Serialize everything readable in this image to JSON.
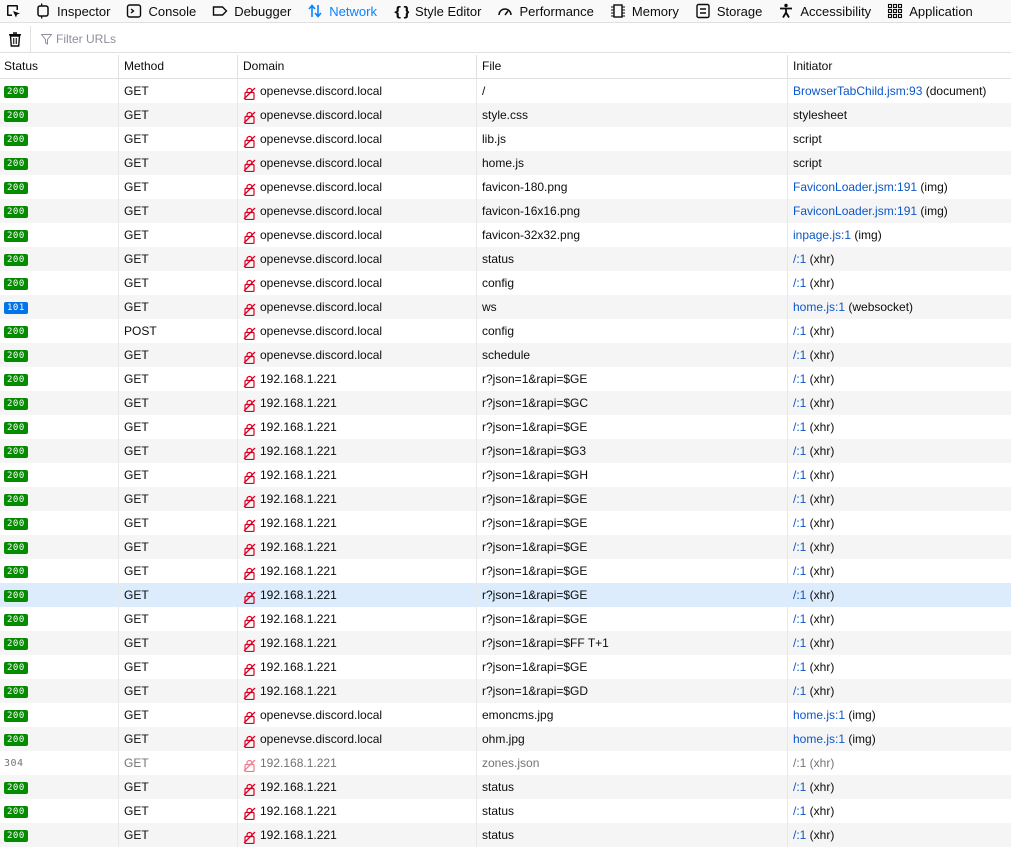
{
  "toolbar": {
    "tabs": [
      {
        "label": "Inspector",
        "icon": "inspector-icon"
      },
      {
        "label": "Console",
        "icon": "console-icon"
      },
      {
        "label": "Debugger",
        "icon": "debugger-icon"
      },
      {
        "label": "Network",
        "icon": "network-icon",
        "selected": true
      },
      {
        "label": "Style Editor",
        "icon": "style-editor-icon"
      },
      {
        "label": "Performance",
        "icon": "performance-icon"
      },
      {
        "label": "Memory",
        "icon": "memory-icon"
      },
      {
        "label": "Storage",
        "icon": "storage-icon"
      },
      {
        "label": "Accessibility",
        "icon": "accessibility-icon"
      },
      {
        "label": "Application",
        "icon": "application-icon"
      }
    ]
  },
  "filter": {
    "placeholder": "Filter URLs",
    "value": ""
  },
  "columns": {
    "status": "Status",
    "method": "Method",
    "domain": "Domain",
    "file": "File",
    "initiator": "Initiator"
  },
  "colors": {
    "accent": "#0a84ff",
    "status_ok": "#058b00",
    "status_switching": "#0074e8",
    "link": "#0b56c8",
    "selected_row": "#dcecfc"
  },
  "rows": [
    {
      "status": "200",
      "method": "GET",
      "domain": "openevse.discord.local",
      "file": "/",
      "init_link": "BrowserTabChild.jsm:93",
      "init_suffix": " (document)"
    },
    {
      "status": "200",
      "method": "GET",
      "domain": "openevse.discord.local",
      "file": "style.css",
      "init_link": "",
      "init_suffix": "stylesheet"
    },
    {
      "status": "200",
      "method": "GET",
      "domain": "openevse.discord.local",
      "file": "lib.js",
      "init_link": "",
      "init_suffix": "script"
    },
    {
      "status": "200",
      "method": "GET",
      "domain": "openevse.discord.local",
      "file": "home.js",
      "init_link": "",
      "init_suffix": "script"
    },
    {
      "status": "200",
      "method": "GET",
      "domain": "openevse.discord.local",
      "file": "favicon-180.png",
      "init_link": "FaviconLoader.jsm:191",
      "init_suffix": " (img)"
    },
    {
      "status": "200",
      "method": "GET",
      "domain": "openevse.discord.local",
      "file": "favicon-16x16.png",
      "init_link": "FaviconLoader.jsm:191",
      "init_suffix": " (img)"
    },
    {
      "status": "200",
      "method": "GET",
      "domain": "openevse.discord.local",
      "file": "favicon-32x32.png",
      "init_link": "inpage.js:1",
      "init_suffix": " (img)"
    },
    {
      "status": "200",
      "method": "GET",
      "domain": "openevse.discord.local",
      "file": "status",
      "init_link": "/:1",
      "init_suffix": " (xhr)"
    },
    {
      "status": "200",
      "method": "GET",
      "domain": "openevse.discord.local",
      "file": "config",
      "init_link": "/:1",
      "init_suffix": " (xhr)"
    },
    {
      "status": "101",
      "method": "GET",
      "domain": "openevse.discord.local",
      "file": "ws",
      "init_link": "home.js:1",
      "init_suffix": " (websocket)"
    },
    {
      "status": "200",
      "method": "POST",
      "domain": "openevse.discord.local",
      "file": "config",
      "init_link": "/:1",
      "init_suffix": " (xhr)"
    },
    {
      "status": "200",
      "method": "GET",
      "domain": "openevse.discord.local",
      "file": "schedule",
      "init_link": "/:1",
      "init_suffix": " (xhr)"
    },
    {
      "status": "200",
      "method": "GET",
      "domain": "192.168.1.221",
      "file": "r?json=1&rapi=$GE",
      "init_link": "/:1",
      "init_suffix": " (xhr)"
    },
    {
      "status": "200",
      "method": "GET",
      "domain": "192.168.1.221",
      "file": "r?json=1&rapi=$GC",
      "init_link": "/:1",
      "init_suffix": " (xhr)"
    },
    {
      "status": "200",
      "method": "GET",
      "domain": "192.168.1.221",
      "file": "r?json=1&rapi=$GE",
      "init_link": "/:1",
      "init_suffix": " (xhr)"
    },
    {
      "status": "200",
      "method": "GET",
      "domain": "192.168.1.221",
      "file": "r?json=1&rapi=$G3",
      "init_link": "/:1",
      "init_suffix": " (xhr)"
    },
    {
      "status": "200",
      "method": "GET",
      "domain": "192.168.1.221",
      "file": "r?json=1&rapi=$GH",
      "init_link": "/:1",
      "init_suffix": " (xhr)"
    },
    {
      "status": "200",
      "method": "GET",
      "domain": "192.168.1.221",
      "file": "r?json=1&rapi=$GE",
      "init_link": "/:1",
      "init_suffix": " (xhr)"
    },
    {
      "status": "200",
      "method": "GET",
      "domain": "192.168.1.221",
      "file": "r?json=1&rapi=$GE",
      "init_link": "/:1",
      "init_suffix": " (xhr)"
    },
    {
      "status": "200",
      "method": "GET",
      "domain": "192.168.1.221",
      "file": "r?json=1&rapi=$GE",
      "init_link": "/:1",
      "init_suffix": " (xhr)"
    },
    {
      "status": "200",
      "method": "GET",
      "domain": "192.168.1.221",
      "file": "r?json=1&rapi=$GE",
      "init_link": "/:1",
      "init_suffix": " (xhr)"
    },
    {
      "status": "200",
      "method": "GET",
      "domain": "192.168.1.221",
      "file": "r?json=1&rapi=$GE",
      "init_link": "/:1",
      "init_suffix": " (xhr)",
      "selected": true
    },
    {
      "status": "200",
      "method": "GET",
      "domain": "192.168.1.221",
      "file": "r?json=1&rapi=$GE",
      "init_link": "/:1",
      "init_suffix": " (xhr)"
    },
    {
      "status": "200",
      "method": "GET",
      "domain": "192.168.1.221",
      "file": "r?json=1&rapi=$FF T+1",
      "init_link": "/:1",
      "init_suffix": " (xhr)"
    },
    {
      "status": "200",
      "method": "GET",
      "domain": "192.168.1.221",
      "file": "r?json=1&rapi=$GE",
      "init_link": "/:1",
      "init_suffix": " (xhr)"
    },
    {
      "status": "200",
      "method": "GET",
      "domain": "192.168.1.221",
      "file": "r?json=1&rapi=$GD",
      "init_link": "/:1",
      "init_suffix": " (xhr)"
    },
    {
      "status": "200",
      "method": "GET",
      "domain": "openevse.discord.local",
      "file": "emoncms.jpg",
      "init_link": "home.js:1",
      "init_suffix": " (img)"
    },
    {
      "status": "200",
      "method": "GET",
      "domain": "openevse.discord.local",
      "file": "ohm.jpg",
      "init_link": "home.js:1",
      "init_suffix": " (img)"
    },
    {
      "status": "304",
      "method": "GET",
      "domain": "192.168.1.221",
      "file": "zones.json",
      "init_link": "/:1",
      "init_suffix": " (xhr)",
      "dim": true
    },
    {
      "status": "200",
      "method": "GET",
      "domain": "192.168.1.221",
      "file": "status",
      "init_link": "/:1",
      "init_suffix": " (xhr)"
    },
    {
      "status": "200",
      "method": "GET",
      "domain": "192.168.1.221",
      "file": "status",
      "init_link": "/:1",
      "init_suffix": " (xhr)"
    },
    {
      "status": "200",
      "method": "GET",
      "domain": "192.168.1.221",
      "file": "status",
      "init_link": "/:1",
      "init_suffix": " (xhr)"
    }
  ]
}
